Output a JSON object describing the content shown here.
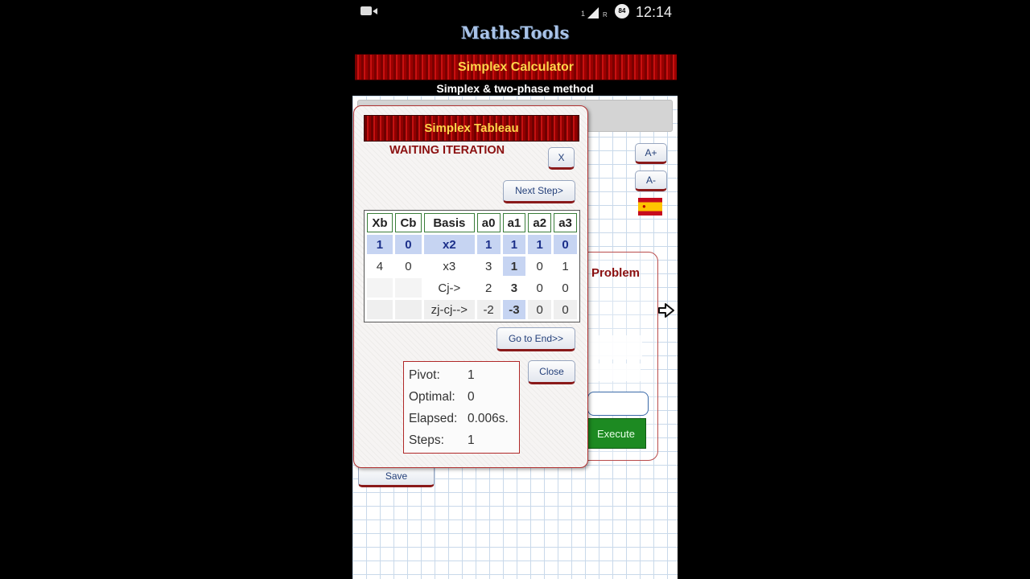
{
  "status_bar": {
    "sim": "1",
    "network": "R",
    "battery": "84",
    "time": "12:14"
  },
  "app": {
    "logo": "MathsTools",
    "banner_title": "Simplex Calculator",
    "subtitle": "Simplex & two-phase method"
  },
  "background": {
    "font_increase": "A+",
    "font_decrease": "A-",
    "problem_label": "Problem",
    "execute_label": "Execute",
    "save_label": "Save"
  },
  "dialog": {
    "title": "Simplex Tableau",
    "status": "WAITING ITERATION",
    "close_x": "X",
    "next_step": "Next Step>",
    "go_to_end": "Go to End>>",
    "close": "Close",
    "table": {
      "headers": [
        "Xb",
        "Cb",
        "Basis",
        "a0",
        "a1",
        "a2",
        "a3"
      ],
      "rows": [
        [
          "1",
          "0",
          "x2",
          "1",
          "1",
          "1",
          "0"
        ],
        [
          "4",
          "0",
          "x3",
          "3",
          "1",
          "0",
          "1"
        ],
        [
          "",
          "",
          "Cj->",
          "2",
          "3",
          "0",
          "0"
        ],
        [
          "",
          "",
          "zj-cj-->",
          "-2",
          "-3",
          "0",
          "0"
        ]
      ]
    },
    "stats": {
      "pivot_label": "Pivot:",
      "pivot_value": "1",
      "optimal_label": "Optimal:",
      "optimal_value": "0",
      "elapsed_label": "Elapsed:",
      "elapsed_value": "0.006s.",
      "steps_label": "Steps:",
      "steps_value": "1"
    }
  }
}
